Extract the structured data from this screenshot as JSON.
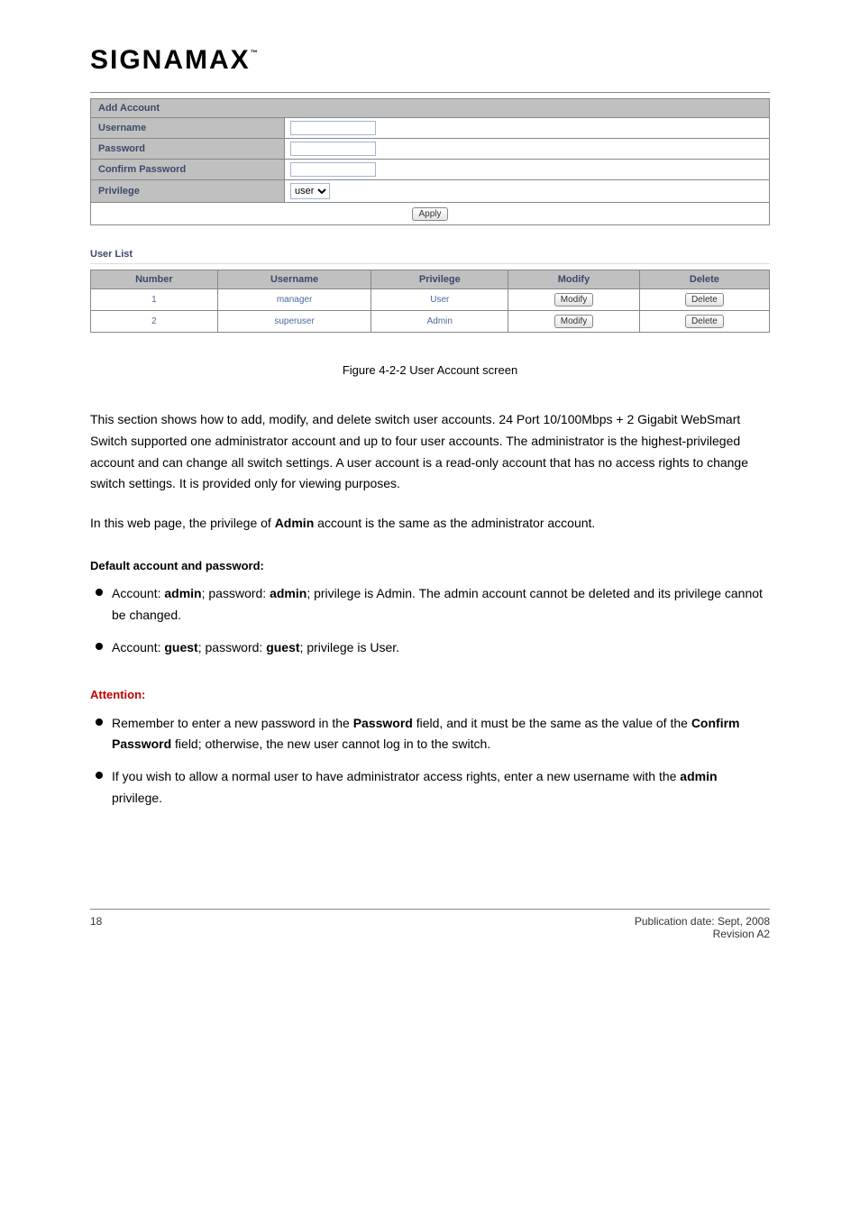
{
  "logo": {
    "text": "SIGNAMAX",
    "tm": "™"
  },
  "form": {
    "header": "Add Account",
    "username_label": "Username",
    "password_label": "Password",
    "confirm_label": "Confirm Password",
    "privilege_label": "Privilege",
    "privilege_value": "user",
    "apply": "Apply"
  },
  "userlist": {
    "title": "User List",
    "headers": {
      "number": "Number",
      "username": "Username",
      "privilege": "Privilege",
      "modify": "Modify",
      "delete": "Delete"
    },
    "rows": [
      {
        "number": "1",
        "username": "manager",
        "privilege": "User",
        "modify": "Modify",
        "delete": "Delete"
      },
      {
        "number": "2",
        "username": "superuser",
        "privilege": "Admin",
        "modify": "Modify",
        "delete": "Delete"
      }
    ]
  },
  "figure_caption": "Figure 4-2-2 User Account screen",
  "intro": {
    "p1": "This section shows how to add, modify, and delete switch user accounts. 24 Port 10/100Mbps + 2 Gigabit WebSmart Switch supported one administrator account and up to four user accounts. The administrator is the highest-privileged account and can change all switch settings. A user account is a read-only account that has no access rights to change switch settings. It is provided only for viewing purposes.",
    "p2_a": "In this web page, the privilege of ",
    "p2_b": " account is the same as the administrator account.",
    "default_label": "Default account and password:"
  },
  "defaults": [
    {
      "label_a": "Account: ",
      "value_a": "admin",
      "label_b": "; password: ",
      "value_b": "admin",
      "trail": "; privilege is Admin. The admin account cannot be deleted and its privilege cannot be changed."
    },
    {
      "label_a": "Account: ",
      "value_a": "guest",
      "value_b": "guest",
      "label_b": "; password: ",
      "trail": "; privilege is User."
    }
  ],
  "warn_heading": "Attention:",
  "warns": [
    {
      "t1": "Remember to enter a new password in the ",
      "b1": "Password",
      "t2": " field, and it must be the same as the value of the ",
      "b2": "Confirm Password",
      "t3": " field; otherwise, the new user cannot log in to the switch."
    },
    {
      "t1": "If you wish to allow a normal user to have administrator access rights, enter a new username with the ",
      "b1": "admin",
      "t2": " privilege."
    }
  ],
  "footer": {
    "page": "18",
    "right": "Publication date: Sept, 2008\nRevision A2"
  }
}
